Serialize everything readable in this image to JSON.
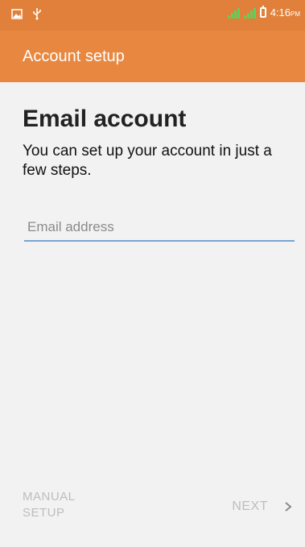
{
  "status_bar": {
    "time": "4:16",
    "time_suffix": "PM",
    "icons": [
      "image-notification-icon",
      "usb-icon",
      "signal-sim1-icon",
      "signal-sim2-icon",
      "battery-icon"
    ]
  },
  "app_bar": {
    "title": "Account setup"
  },
  "main": {
    "heading": "Email account",
    "description": "You can set up your account in just a few steps.",
    "email_field": {
      "value": "",
      "placeholder": "Email address"
    }
  },
  "footer": {
    "manual_setup_label": "MANUAL\nSETUP",
    "next_label": "NEXT",
    "next_icon": "chevron-right-icon"
  },
  "colors": {
    "status_bar": "#e0803a",
    "app_bar": "#e8873f",
    "background": "#f2f2f2",
    "field_underline": "#7ba2d6",
    "disabled_text": "#bdbdbd"
  }
}
